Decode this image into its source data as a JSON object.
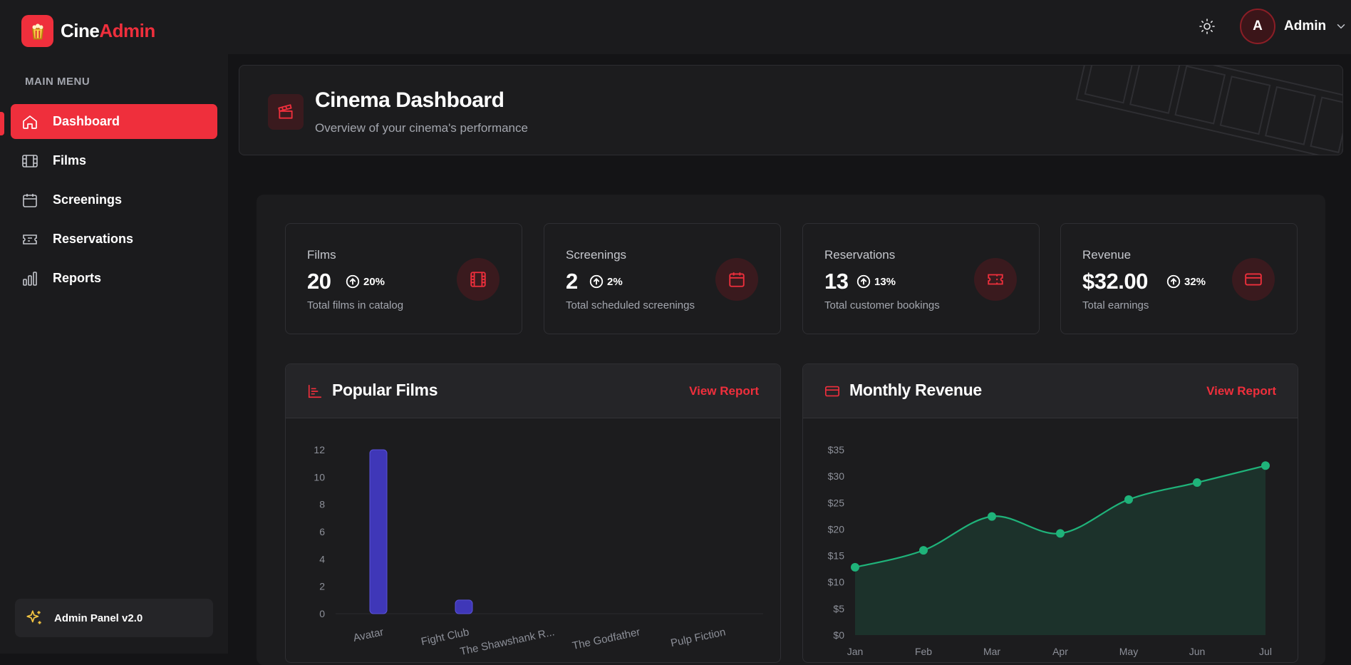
{
  "brand": {
    "name_main": "Cine",
    "name_accent": "Admin"
  },
  "user": {
    "initial": "A",
    "name": "Admin"
  },
  "sidebar": {
    "section_title": "MAIN MENU",
    "items": [
      {
        "label": "Dashboard",
        "icon": "home-icon",
        "active": true
      },
      {
        "label": "Films",
        "icon": "film-icon",
        "active": false
      },
      {
        "label": "Screenings",
        "icon": "calendar-icon",
        "active": false
      },
      {
        "label": "Reservations",
        "icon": "ticket-icon",
        "active": false
      },
      {
        "label": "Reports",
        "icon": "bar-chart-icon",
        "active": false
      }
    ],
    "version": "Admin Panel v2.0"
  },
  "header": {
    "title": "Cinema Dashboard",
    "subtitle": "Overview of your cinema's performance",
    "icon": "clapperboard-icon"
  },
  "stats": [
    {
      "label": "Films",
      "value": "20",
      "trend": "20%",
      "desc": "Total films in catalog",
      "icon": "film-icon"
    },
    {
      "label": "Screenings",
      "value": "2",
      "trend": "2%",
      "desc": "Total scheduled screenings",
      "icon": "calendar-icon"
    },
    {
      "label": "Reservations",
      "value": "13",
      "trend": "13%",
      "desc": "Total customer bookings",
      "icon": "ticket-icon"
    },
    {
      "label": "Revenue",
      "value": "$32.00",
      "trend": "32%",
      "desc": "Total earnings",
      "icon": "credit-card-icon"
    }
  ],
  "charts": {
    "popular": {
      "title": "Popular Films",
      "link": "View Report"
    },
    "revenue": {
      "title": "Monthly Revenue",
      "link": "View Report"
    }
  },
  "colors": {
    "accent": "#ef2f3c",
    "bar": "#3f37b8",
    "line": "#1fb37a"
  },
  "chart_data": [
    {
      "type": "bar",
      "title": "Popular Films",
      "categories": [
        "Avatar",
        "Fight Club",
        "The Shawshank R...",
        "The Godfather",
        "Pulp Fiction"
      ],
      "values": [
        12,
        1,
        0,
        0,
        0
      ],
      "yticks": [
        0,
        2,
        4,
        6,
        8,
        10,
        12
      ],
      "ylim": [
        0,
        12
      ],
      "grid": false
    },
    {
      "type": "area",
      "title": "Monthly Revenue",
      "categories": [
        "Jan",
        "Feb",
        "Mar",
        "Apr",
        "May",
        "Jun",
        "Jul"
      ],
      "values": [
        12.8,
        16,
        22.4,
        19.2,
        25.6,
        28.8,
        32
      ],
      "yticks": [
        "$0",
        "$5",
        "$10",
        "$15",
        "$20",
        "$25",
        "$30",
        "$35"
      ],
      "ylim": [
        0,
        35
      ],
      "grid": false
    }
  ]
}
